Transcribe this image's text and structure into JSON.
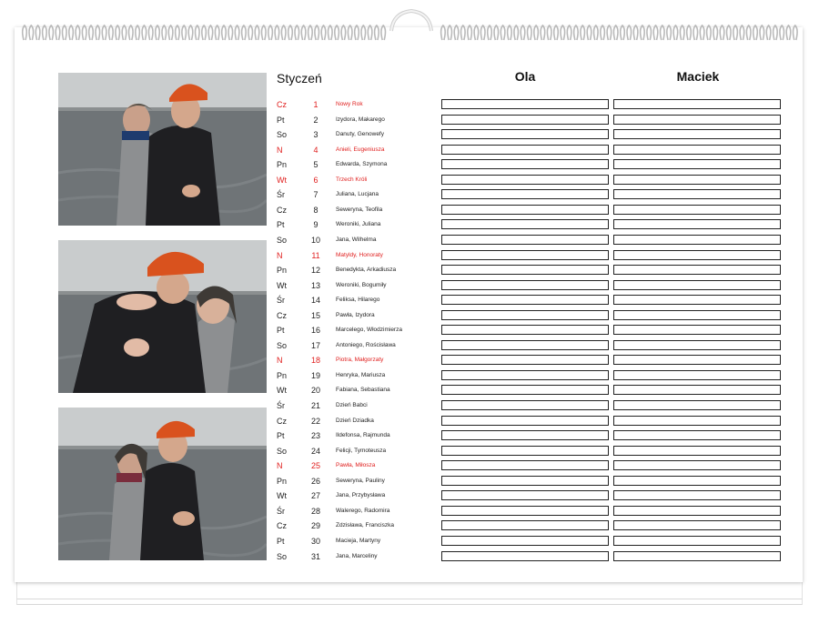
{
  "month": "Styczeń",
  "people": [
    "Ola",
    "Maciek"
  ],
  "days": [
    {
      "day": "Cz",
      "num": "1",
      "name": "Nowy Rok",
      "holiday": true
    },
    {
      "day": "Pt",
      "num": "2",
      "name": "Izydora, Makarego",
      "holiday": false
    },
    {
      "day": "So",
      "num": "3",
      "name": "Danuty, Genowefy",
      "holiday": false
    },
    {
      "day": "N",
      "num": "4",
      "name": "Anieli, Eugeniusza",
      "holiday": true
    },
    {
      "day": "Pn",
      "num": "5",
      "name": "Edwarda, Szymona",
      "holiday": false
    },
    {
      "day": "Wt",
      "num": "6",
      "name": "Trzech Króli",
      "holiday": true
    },
    {
      "day": "Śr",
      "num": "7",
      "name": "Juliana, Lucjana",
      "holiday": false
    },
    {
      "day": "Cz",
      "num": "8",
      "name": "Seweryna, Teofila",
      "holiday": false
    },
    {
      "day": "Pt",
      "num": "9",
      "name": "Weroniki, Juliana",
      "holiday": false
    },
    {
      "day": "So",
      "num": "10",
      "name": "Jana, Wilhelma",
      "holiday": false
    },
    {
      "day": "N",
      "num": "11",
      "name": "Matyldy, Honoraty",
      "holiday": true
    },
    {
      "day": "Pn",
      "num": "12",
      "name": "Benedykta, Arkadiusza",
      "holiday": false
    },
    {
      "day": "Wt",
      "num": "13",
      "name": "Weroniki, Bogumiły",
      "holiday": false
    },
    {
      "day": "Śr",
      "num": "14",
      "name": "Feliksa, Hilarego",
      "holiday": false
    },
    {
      "day": "Cz",
      "num": "15",
      "name": "Pawła, Izydora",
      "holiday": false
    },
    {
      "day": "Pt",
      "num": "16",
      "name": "Marcelego, Włodzimierza",
      "holiday": false
    },
    {
      "day": "So",
      "num": "17",
      "name": "Antoniego, Rościsława",
      "holiday": false
    },
    {
      "day": "N",
      "num": "18",
      "name": "Piotra, Małgorzaty",
      "holiday": true
    },
    {
      "day": "Pn",
      "num": "19",
      "name": "Henryka, Mariusza",
      "holiday": false
    },
    {
      "day": "Wt",
      "num": "20",
      "name": "Fabiana, Sebastiana",
      "holiday": false
    },
    {
      "day": "Śr",
      "num": "21",
      "name": "Dzień Babci",
      "holiday": false
    },
    {
      "day": "Cz",
      "num": "22",
      "name": "Dzień Dziadka",
      "holiday": false
    },
    {
      "day": "Pt",
      "num": "23",
      "name": "Ildefonsa, Rajmunda",
      "holiday": false
    },
    {
      "day": "So",
      "num": "24",
      "name": "Felicji, Tymoteusza",
      "holiday": false
    },
    {
      "day": "N",
      "num": "25",
      "name": "Pawła, Miłosza",
      "holiday": true
    },
    {
      "day": "Pn",
      "num": "26",
      "name": "Seweryna, Pauliny",
      "holiday": false
    },
    {
      "day": "Wt",
      "num": "27",
      "name": "Jana, Przybysława",
      "holiday": false
    },
    {
      "day": "Śr",
      "num": "28",
      "name": "Walerego, Radomira",
      "holiday": false
    },
    {
      "day": "Cz",
      "num": "29",
      "name": "Zdzisława, Franciszka",
      "holiday": false
    },
    {
      "day": "Pt",
      "num": "30",
      "name": "Macieja, Martyny",
      "holiday": false
    },
    {
      "day": "So",
      "num": "31",
      "name": "Jana, Marceliny",
      "holiday": false
    }
  ],
  "colors": {
    "holiday": "#e0201f",
    "text": "#222222",
    "coat": "#1f1f22",
    "hat": "#d9521e",
    "water": "#6f7477",
    "sky": "#c9cccd"
  }
}
